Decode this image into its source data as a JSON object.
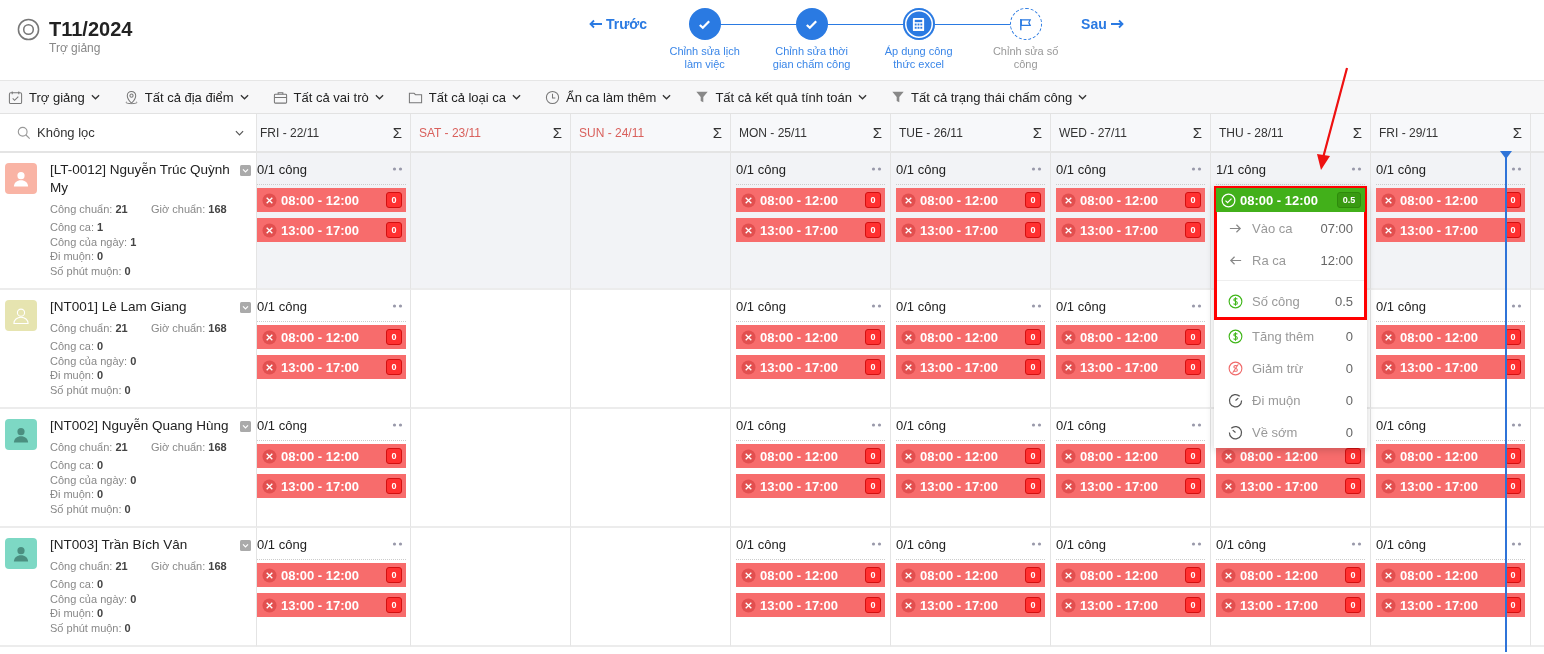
{
  "header": {
    "title": "T11/2024",
    "subtitle": "Trợ giảng",
    "prev": "Trước",
    "next": "Sau",
    "steps": [
      {
        "label": "Chỉnh sửa lịch làm việc",
        "kind": "done"
      },
      {
        "label": "Chỉnh sửa thời gian chấm công",
        "kind": "done"
      },
      {
        "label": "Áp dụng công thức excel",
        "kind": "current"
      },
      {
        "label": "Chỉnh sửa số công",
        "kind": "pending"
      }
    ]
  },
  "filters": [
    {
      "kind": "calendar",
      "label": "Trợ giảng"
    },
    {
      "kind": "pin",
      "label": "Tất cả địa điểm"
    },
    {
      "kind": "briefcase",
      "label": "Tất cả vai trò"
    },
    {
      "kind": "folder",
      "label": "Tất cả loại ca"
    },
    {
      "kind": "clock",
      "label": "Ẩn ca làm thêm"
    },
    {
      "kind": "filter",
      "label": "Tất cả kết quả tính toán"
    },
    {
      "kind": "filter",
      "label": "Tất cả trạng thái chấm công"
    }
  ],
  "filter_select": {
    "value": "Không lọc"
  },
  "columns": [
    {
      "label": "FRI - 22/11",
      "weekend": false,
      "sum": "Σ",
      "now_marker": false
    },
    {
      "label": "SAT - 23/11",
      "weekend": true,
      "sum": "Σ",
      "now_marker": false
    },
    {
      "label": "SUN - 24/11",
      "weekend": true,
      "sum": "Σ",
      "now_marker": false
    },
    {
      "label": "MON - 25/11",
      "weekend": false,
      "sum": "Σ",
      "now_marker": false
    },
    {
      "label": "TUE - 26/11",
      "weekend": false,
      "sum": "Σ",
      "now_marker": false
    },
    {
      "label": "WED - 27/11",
      "weekend": false,
      "sum": "Σ",
      "now_marker": false
    },
    {
      "label": "THU - 28/11",
      "weekend": false,
      "sum": "Σ",
      "now_marker": false
    },
    {
      "label": "FRI - 29/11",
      "weekend": false,
      "sum": "Σ",
      "now_marker": true
    }
  ],
  "rows": [
    {
      "name": "[LT-0012] Nguyễn Trúc Quỳnh My",
      "avatar": {
        "color": "#f9b4a5",
        "kind": "light"
      },
      "highlighted": true,
      "stats": [
        "Công chuẩn: **21**",
        "Giờ chuẩn: **168**",
        "Công ca: **1**",
        "Công của ngày: **1**",
        "Đi muộn: **0**",
        "Số phút muộn: **0**"
      ],
      "cells": [
        {
          "summary": "0/1 công",
          "shifts": [
            {
              "time": "08:00 - 12:00",
              "kind": "absent",
              "count": "0"
            },
            {
              "time": "13:00 - 17:00",
              "kind": "absent",
              "count": "0"
            }
          ]
        },
        null,
        null,
        {
          "summary": "0/1 công",
          "shifts": [
            {
              "time": "08:00 - 12:00",
              "kind": "absent",
              "count": "0"
            },
            {
              "time": "13:00 - 17:00",
              "kind": "absent",
              "count": "0"
            }
          ]
        },
        {
          "summary": "0/1 công",
          "shifts": [
            {
              "time": "08:00 - 12:00",
              "kind": "absent",
              "count": "0"
            },
            {
              "time": "13:00 - 17:00",
              "kind": "absent",
              "count": "0"
            }
          ]
        },
        {
          "summary": "0/1 công",
          "shifts": [
            {
              "time": "08:00 - 12:00",
              "kind": "absent",
              "count": "0"
            },
            {
              "time": "13:00 - 17:00",
              "kind": "absent",
              "count": "0"
            }
          ]
        },
        {
          "summary": "1/1 công",
          "shifts": [
            {
              "time": "08:00 - 12:00",
              "kind": "done",
              "count": "0.5",
              "popup": {
                "arrow": true,
                "framed_items": [
                  {
                    "kind": "arrow-right",
                    "label": "Vào ca",
                    "value": "07:00"
                  },
                  {
                    "kind": "arrow-left",
                    "label": "Ra ca",
                    "value": "12:00"
                  },
                  {
                    "kind": "divider"
                  },
                  {
                    "kind": "coin",
                    "label": "Số công",
                    "value": "0.5"
                  }
                ],
                "items": [
                  {
                    "kind": "coin",
                    "label": "Tăng thêm",
                    "value": "0"
                  },
                  {
                    "kind": "coin-off",
                    "label": "Giảm trừ",
                    "value": "0"
                  },
                  {
                    "kind": "late",
                    "label": "Đi muộn",
                    "value": "0"
                  },
                  {
                    "kind": "early",
                    "label": "Về sớm",
                    "value": "0"
                  }
                ]
              }
            }
          ]
        },
        {
          "summary": "0/1 công",
          "shifts": [
            {
              "time": "08:00 - 12:00",
              "kind": "absent",
              "count": "0"
            },
            {
              "time": "13:00 - 17:00",
              "kind": "absent",
              "count": "0"
            }
          ]
        }
      ]
    },
    {
      "name": "[NT001] Lê Lam Giang",
      "avatar": {
        "color": "#e6e4b0",
        "kind": "outline"
      },
      "highlighted": false,
      "stats": [
        "Công chuẩn: **21**",
        "Giờ chuẩn: **168**",
        "Công ca: **0**",
        "Công của ngày: **0**",
        "Đi muộn: **0**",
        "Số phút muộn: **0**"
      ],
      "cells": [
        {
          "summary": "0/1 công",
          "shifts": [
            {
              "time": "08:00 - 12:00",
              "kind": "absent",
              "count": "0"
            },
            {
              "time": "13:00 - 17:00",
              "kind": "absent",
              "count": "0"
            }
          ]
        },
        null,
        null,
        {
          "summary": "0/1 công",
          "shifts": [
            {
              "time": "08:00 - 12:00",
              "kind": "absent",
              "count": "0"
            },
            {
              "time": "13:00 - 17:00",
              "kind": "absent",
              "count": "0"
            }
          ]
        },
        {
          "summary": "0/1 công",
          "shifts": [
            {
              "time": "08:00 - 12:00",
              "kind": "absent",
              "count": "0"
            },
            {
              "time": "13:00 - 17:00",
              "kind": "absent",
              "count": "0"
            }
          ]
        },
        {
          "summary": "0/1 công",
          "shifts": [
            {
              "time": "08:00 - 12:00",
              "kind": "absent",
              "count": "0"
            },
            {
              "time": "13:00 - 17:00",
              "kind": "absent",
              "count": "0"
            }
          ]
        },
        null,
        {
          "summary": "0/1 công",
          "shifts": [
            {
              "time": "08:00 - 12:00",
              "kind": "absent",
              "count": "0"
            },
            {
              "time": "13:00 - 17:00",
              "kind": "absent",
              "count": "0"
            }
          ]
        }
      ]
    },
    {
      "name": "[NT002] Nguyễn Quang Hùng",
      "avatar": {
        "color": "#7dd8c4",
        "kind": "dark"
      },
      "highlighted": false,
      "stats": [
        "Công chuẩn: **21**",
        "Giờ chuẩn: **168**",
        "Công ca: **0**",
        "Công của ngày: **0**",
        "Đi muộn: **0**",
        "Số phút muộn: **0**"
      ],
      "cells": [
        {
          "summary": "0/1 công",
          "shifts": [
            {
              "time": "08:00 - 12:00",
              "kind": "absent",
              "count": "0"
            },
            {
              "time": "13:00 - 17:00",
              "kind": "absent",
              "count": "0"
            }
          ]
        },
        null,
        null,
        {
          "summary": "0/1 công",
          "shifts": [
            {
              "time": "08:00 - 12:00",
              "kind": "absent",
              "count": "0"
            },
            {
              "time": "13:00 - 17:00",
              "kind": "absent",
              "count": "0"
            }
          ]
        },
        {
          "summary": "0/1 công",
          "shifts": [
            {
              "time": "08:00 - 12:00",
              "kind": "absent",
              "count": "0"
            },
            {
              "time": "13:00 - 17:00",
              "kind": "absent",
              "count": "0"
            }
          ]
        },
        {
          "summary": "0/1 công",
          "shifts": [
            {
              "time": "08:00 - 12:00",
              "kind": "absent",
              "count": "0"
            },
            {
              "time": "13:00 - 17:00",
              "kind": "absent",
              "count": "0"
            }
          ]
        },
        {
          "shifts": [
            {
              "time": "08:00 - 12:00",
              "kind": "absent",
              "count": "0"
            },
            {
              "time": "13:00 - 17:00",
              "kind": "absent",
              "count": "0"
            }
          ]
        },
        {
          "summary": "0/1 công",
          "shifts": [
            {
              "time": "08:00 - 12:00",
              "kind": "absent",
              "count": "0"
            },
            {
              "time": "13:00 - 17:00",
              "kind": "absent",
              "count": "0"
            }
          ]
        }
      ]
    },
    {
      "name": "[NT003] Trần Bích Vân",
      "avatar": {
        "color": "#7dd8c4",
        "kind": "dark"
      },
      "highlighted": false,
      "stats": [
        "Công chuẩn: **21**",
        "Giờ chuẩn: **168**",
        "Công ca: **0**",
        "Công của ngày: **0**",
        "Đi muộn: **0**",
        "Số phút muộn: **0**"
      ],
      "cells": [
        {
          "summary": "0/1 công",
          "shifts": [
            {
              "time": "08:00 - 12:00",
              "kind": "absent",
              "count": "0"
            },
            {
              "time": "13:00 - 17:00",
              "kind": "absent",
              "count": "0"
            }
          ]
        },
        null,
        null,
        {
          "summary": "0/1 công",
          "shifts": [
            {
              "time": "08:00 - 12:00",
              "kind": "absent",
              "count": "0"
            },
            {
              "time": "13:00 - 17:00",
              "kind": "absent",
              "count": "0"
            }
          ]
        },
        {
          "summary": "0/1 công",
          "shifts": [
            {
              "time": "08:00 - 12:00",
              "kind": "absent",
              "count": "0"
            },
            {
              "time": "13:00 - 17:00",
              "kind": "absent",
              "count": "0"
            }
          ]
        },
        {
          "summary": "0/1 công",
          "shifts": [
            {
              "time": "08:00 - 12:00",
              "kind": "absent",
              "count": "0"
            },
            {
              "time": "13:00 - 17:00",
              "kind": "absent",
              "count": "0"
            }
          ]
        },
        {
          "summary": "0/1 công",
          "shifts": [
            {
              "time": "08:00 - 12:00",
              "kind": "absent",
              "count": "0"
            },
            {
              "time": "13:00 - 17:00",
              "kind": "absent",
              "count": "0"
            }
          ]
        },
        {
          "summary": "0/1 công",
          "shifts": [
            {
              "time": "08:00 - 12:00",
              "kind": "absent",
              "count": "0"
            },
            {
              "time": "13:00 - 17:00",
              "kind": "absent",
              "count": "0"
            }
          ]
        }
      ]
    }
  ]
}
